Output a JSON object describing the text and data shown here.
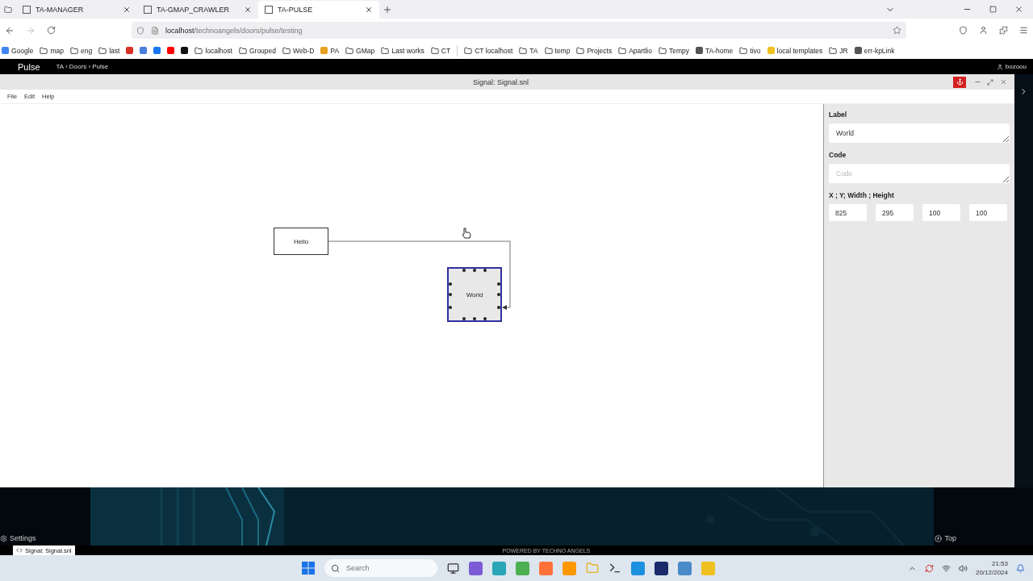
{
  "browser": {
    "tabs": [
      {
        "title": "TA-MANAGER",
        "selected": false
      },
      {
        "title": "TA-GMAP_CRAWLER",
        "selected": false
      },
      {
        "title": "TA-PULSE",
        "selected": true
      }
    ],
    "url": {
      "host": "localhost",
      "path": "/technoangels/doors/pulse/testing"
    },
    "bookmarks": [
      {
        "kind": "site",
        "label": "Google",
        "color": "#4285f4"
      },
      {
        "kind": "folder",
        "label": "map"
      },
      {
        "kind": "folder",
        "label": "eng"
      },
      {
        "kind": "folder",
        "label": "last"
      },
      {
        "kind": "icon",
        "color": "#d93025"
      },
      {
        "kind": "icon",
        "color": "#4a7fe0"
      },
      {
        "kind": "icon",
        "color": "#1877f2"
      },
      {
        "kind": "icon",
        "color": "#ff0000"
      },
      {
        "kind": "icon",
        "color": "#111111"
      },
      {
        "kind": "folder",
        "label": "localhost"
      },
      {
        "kind": "folder",
        "label": "Grouped"
      },
      {
        "kind": "folder",
        "label": "Web-D"
      },
      {
        "kind": "site",
        "label": "PA",
        "color": "#e8a020"
      },
      {
        "kind": "folder",
        "label": "GMap"
      },
      {
        "kind": "folder",
        "label": "Last works"
      },
      {
        "kind": "folder",
        "label": "CT"
      },
      {
        "kind": "separator"
      },
      {
        "kind": "folder",
        "label": "CT localhost"
      },
      {
        "kind": "folder",
        "label": "TA"
      },
      {
        "kind": "folder",
        "label": "temp"
      },
      {
        "kind": "folder",
        "label": "Projects"
      },
      {
        "kind": "folder",
        "label": "Apartlio"
      },
      {
        "kind": "folder",
        "label": "Tempy"
      },
      {
        "kind": "site",
        "label": "TA-home",
        "color": "#555555"
      },
      {
        "kind": "folder",
        "label": "tivo"
      },
      {
        "kind": "site",
        "label": "local templates",
        "color": "#f0c020"
      },
      {
        "kind": "folder",
        "label": "JR"
      },
      {
        "kind": "site",
        "label": "err-kpLink",
        "color": "#555555"
      }
    ]
  },
  "app_header": {
    "title": "Pulse",
    "breadcrumb": "TA › Doors › Pulse",
    "user": "bozoou"
  },
  "window": {
    "title": "Signal: Signal.snl",
    "menu": [
      "File",
      "Edit",
      "Help"
    ]
  },
  "diagram": {
    "nodes": [
      {
        "label": "Hello",
        "selected": false
      },
      {
        "label": "World",
        "selected": true
      }
    ]
  },
  "properties": {
    "label_field": {
      "label": "Label",
      "value": "World"
    },
    "code_field": {
      "label": "Code",
      "placeholder": "Code"
    },
    "geometry": {
      "label": "X ; Y; Width ; Height",
      "values": [
        "825",
        "295",
        "100",
        "100"
      ]
    }
  },
  "footer": {
    "settings": "Settings",
    "top": "Top",
    "doc_tab": "Signal: Signal.snl",
    "powered_by": "POWERED BY TECHNO ANGELS"
  },
  "taskbar": {
    "search_placeholder": "Search",
    "time": "21:53",
    "date": "20/12/2024"
  }
}
